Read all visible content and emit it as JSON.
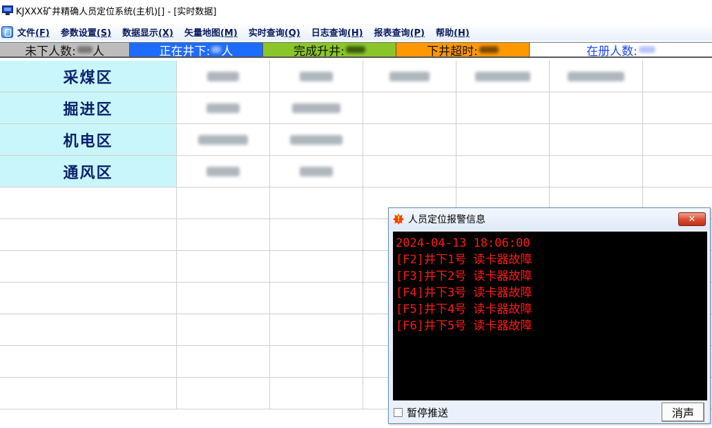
{
  "window": {
    "title": "KJXXX矿井精确人员定位系统(主机)[] - [实时数据]"
  },
  "menu": {
    "items": [
      {
        "label": "文件",
        "accel": "(F)"
      },
      {
        "label": "参数设置",
        "accel": "(S)"
      },
      {
        "label": "数据显示",
        "accel": "(X)"
      },
      {
        "label": "矢量地图",
        "accel": "(M)"
      },
      {
        "label": "实时查询",
        "accel": "(Q)"
      },
      {
        "label": "日志查询",
        "accel": "(H)"
      },
      {
        "label": "报表查询",
        "accel": "(P)"
      },
      {
        "label": "帮助",
        "accel": "(H)"
      }
    ]
  },
  "status": {
    "not_down": "未下人数:",
    "underground": "正在井下:",
    "completed": "完成升井:",
    "overtime": "下井超时:",
    "registered": "在册人数:",
    "not_down_unit": "人",
    "underground_unit": "人"
  },
  "areas": [
    {
      "name": "采煤区"
    },
    {
      "name": "掘进区"
    },
    {
      "name": "机电区"
    },
    {
      "name": "通风区"
    }
  ],
  "alert": {
    "title": "人员定位报警信息",
    "close_glyph": "✕",
    "lines": [
      "2024-04-13 18:06:00",
      "[F2]井下1号 读卡器故障",
      "[F3]井下2号 读卡器故障",
      "[F4]井下3号 读卡器故障",
      "[F5]井下4号 读卡器故障",
      "[F6]井下5号 读卡器故障"
    ],
    "pause_label": "暂停推送",
    "mute_label": "消声"
  },
  "colors": {
    "status_gray": "#bdbdbd",
    "status_blue": "#1e6cff",
    "status_green": "#8ac627",
    "status_orange": "#ff9800",
    "area_header_bg": "#c8f6fa",
    "alert_text": "#ff1a1a"
  }
}
